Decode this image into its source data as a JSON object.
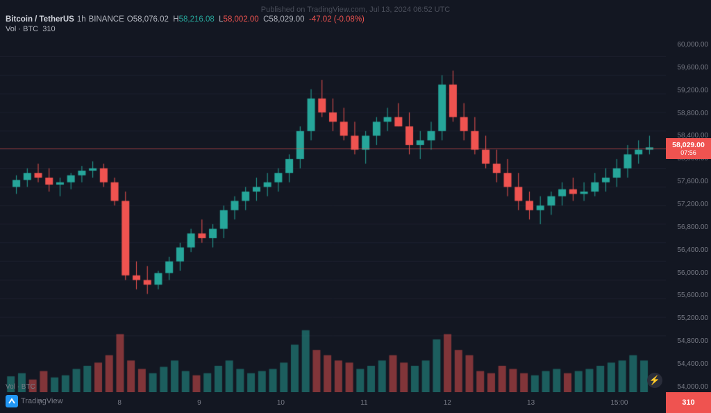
{
  "watermark": {
    "text": "Published on TradingView.com, Jul 13, 2024 06:52 UTC"
  },
  "header": {
    "pair": "Bitcoin / TetherUS",
    "timeframe": "1h",
    "exchange": "BINANCE",
    "open_label": "O",
    "open_val": "58,076.02",
    "high_label": "H",
    "high_val": "58,216.08",
    "low_label": "L",
    "low_val": "58,002.00",
    "close_label": "C",
    "close_val": "58,029.00",
    "change": "-47.02 (-0.08%)",
    "vol_label": "Vol · BTC",
    "vol_val": "310"
  },
  "current_price": {
    "price": "58,029.00",
    "time": "07:56"
  },
  "price_levels": [
    "60,000.00",
    "59,600.00",
    "59,200.00",
    "58,800.00",
    "58,400.00",
    "58,000.00",
    "57,600.00",
    "57,200.00",
    "56,800.00",
    "56,400.00",
    "56,000.00",
    "55,600.00",
    "55,200.00",
    "54,800.00",
    "54,400.00",
    "54,000.00"
  ],
  "time_labels": [
    "7",
    "8",
    "9",
    "10",
    "11",
    "12",
    "13",
    "15:00"
  ],
  "vol_box": "310",
  "lightning_icon": "⚡",
  "logo_text": "TradingView"
}
